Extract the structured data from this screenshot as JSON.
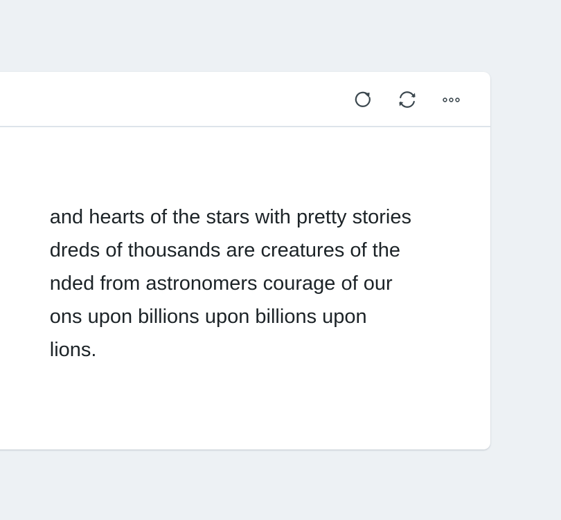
{
  "card": {
    "toolbar": {
      "refresh_icon": "refresh-icon",
      "sync_icon": "sync-icon",
      "more_icon": "more-horizontal-icon"
    },
    "content": {
      "lines": [
        "and hearts of the stars with pretty stories",
        "dreds of thousands are creatures of the",
        "nded from astronomers courage of our",
        "ons upon billions upon billions upon",
        "lions."
      ]
    }
  },
  "colors": {
    "page_background": "#edf1f4",
    "card_background": "#ffffff",
    "divider": "#dde4ea",
    "icon": "#3b474e",
    "text": "#1c2327"
  }
}
